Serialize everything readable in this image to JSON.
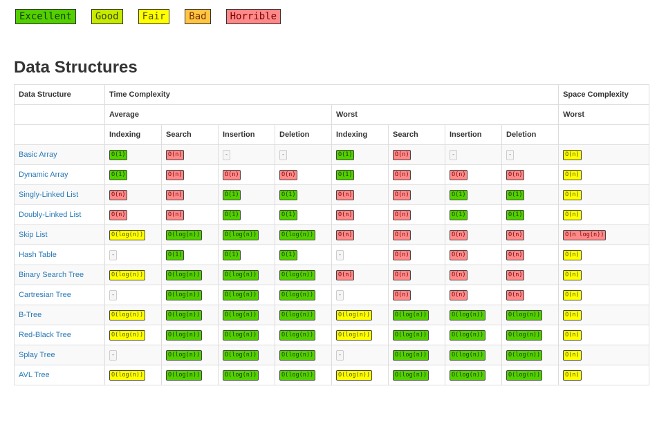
{
  "colors": {
    "excellent": "#53d000",
    "good": "#c8ea00",
    "fair": "#ffff00",
    "bad": "#ffc543",
    "horrible": "#ff8989",
    "link": "#2a7ab8"
  },
  "legend": [
    {
      "label": "Excellent",
      "level": "excellent"
    },
    {
      "label": "Good",
      "level": "good"
    },
    {
      "label": "Fair",
      "level": "fair"
    },
    {
      "label": "Bad",
      "level": "bad"
    },
    {
      "label": "Horrible",
      "level": "horrible"
    }
  ],
  "title": "Data Structures",
  "table": {
    "header": {
      "data_structure": "Data Structure",
      "time_complexity": "Time Complexity",
      "space_complexity": "Space Complexity",
      "average": "Average",
      "worst": "Worst",
      "space_worst": "Worst",
      "ops": [
        "Indexing",
        "Search",
        "Insertion",
        "Deletion",
        "Indexing",
        "Search",
        "Insertion",
        "Deletion"
      ]
    },
    "rows": [
      {
        "name": "Basic Array",
        "cells": [
          {
            "t": "O(1)",
            "c": "excellent"
          },
          {
            "t": "O(n)",
            "c": "horrible"
          },
          {
            "t": "-",
            "c": "none"
          },
          {
            "t": "-",
            "c": "none"
          },
          {
            "t": "O(1)",
            "c": "excellent"
          },
          {
            "t": "O(n)",
            "c": "horrible"
          },
          {
            "t": "-",
            "c": "none"
          },
          {
            "t": "-",
            "c": "none"
          },
          {
            "t": "O(n)",
            "c": "fair"
          }
        ]
      },
      {
        "name": "Dynamic Array",
        "cells": [
          {
            "t": "O(1)",
            "c": "excellent"
          },
          {
            "t": "O(n)",
            "c": "horrible"
          },
          {
            "t": "O(n)",
            "c": "horrible"
          },
          {
            "t": "O(n)",
            "c": "horrible"
          },
          {
            "t": "O(1)",
            "c": "excellent"
          },
          {
            "t": "O(n)",
            "c": "horrible"
          },
          {
            "t": "O(n)",
            "c": "horrible"
          },
          {
            "t": "O(n)",
            "c": "horrible"
          },
          {
            "t": "O(n)",
            "c": "fair"
          }
        ]
      },
      {
        "name": "Singly-Linked List",
        "cells": [
          {
            "t": "O(n)",
            "c": "horrible"
          },
          {
            "t": "O(n)",
            "c": "horrible"
          },
          {
            "t": "O(1)",
            "c": "excellent"
          },
          {
            "t": "O(1)",
            "c": "excellent"
          },
          {
            "t": "O(n)",
            "c": "horrible"
          },
          {
            "t": "O(n)",
            "c": "horrible"
          },
          {
            "t": "O(1)",
            "c": "excellent"
          },
          {
            "t": "O(1)",
            "c": "excellent"
          },
          {
            "t": "O(n)",
            "c": "fair"
          }
        ]
      },
      {
        "name": "Doubly-Linked List",
        "cells": [
          {
            "t": "O(n)",
            "c": "horrible"
          },
          {
            "t": "O(n)",
            "c": "horrible"
          },
          {
            "t": "O(1)",
            "c": "excellent"
          },
          {
            "t": "O(1)",
            "c": "excellent"
          },
          {
            "t": "O(n)",
            "c": "horrible"
          },
          {
            "t": "O(n)",
            "c": "horrible"
          },
          {
            "t": "O(1)",
            "c": "excellent"
          },
          {
            "t": "O(1)",
            "c": "excellent"
          },
          {
            "t": "O(n)",
            "c": "fair"
          }
        ]
      },
      {
        "name": "Skip List",
        "cells": [
          {
            "t": "O(log(n))",
            "c": "fair"
          },
          {
            "t": "O(log(n))",
            "c": "excellent"
          },
          {
            "t": "O(log(n))",
            "c": "excellent"
          },
          {
            "t": "O(log(n))",
            "c": "excellent"
          },
          {
            "t": "O(n)",
            "c": "horrible"
          },
          {
            "t": "O(n)",
            "c": "horrible"
          },
          {
            "t": "O(n)",
            "c": "horrible"
          },
          {
            "t": "O(n)",
            "c": "horrible"
          },
          {
            "t": "O(n log(n))",
            "c": "horrible"
          }
        ]
      },
      {
        "name": "Hash Table",
        "cells": [
          {
            "t": "-",
            "c": "none"
          },
          {
            "t": "O(1)",
            "c": "excellent"
          },
          {
            "t": "O(1)",
            "c": "excellent"
          },
          {
            "t": "O(1)",
            "c": "excellent"
          },
          {
            "t": "-",
            "c": "none"
          },
          {
            "t": "O(n)",
            "c": "horrible"
          },
          {
            "t": "O(n)",
            "c": "horrible"
          },
          {
            "t": "O(n)",
            "c": "horrible"
          },
          {
            "t": "O(n)",
            "c": "fair"
          }
        ]
      },
      {
        "name": "Binary Search Tree",
        "cells": [
          {
            "t": "O(log(n))",
            "c": "fair"
          },
          {
            "t": "O(log(n))",
            "c": "excellent"
          },
          {
            "t": "O(log(n))",
            "c": "excellent"
          },
          {
            "t": "O(log(n))",
            "c": "excellent"
          },
          {
            "t": "O(n)",
            "c": "horrible"
          },
          {
            "t": "O(n)",
            "c": "horrible"
          },
          {
            "t": "O(n)",
            "c": "horrible"
          },
          {
            "t": "O(n)",
            "c": "horrible"
          },
          {
            "t": "O(n)",
            "c": "fair"
          }
        ]
      },
      {
        "name": "Cartresian Tree",
        "cells": [
          {
            "t": "-",
            "c": "none"
          },
          {
            "t": "O(log(n))",
            "c": "excellent"
          },
          {
            "t": "O(log(n))",
            "c": "excellent"
          },
          {
            "t": "O(log(n))",
            "c": "excellent"
          },
          {
            "t": "-",
            "c": "none"
          },
          {
            "t": "O(n)",
            "c": "horrible"
          },
          {
            "t": "O(n)",
            "c": "horrible"
          },
          {
            "t": "O(n)",
            "c": "horrible"
          },
          {
            "t": "O(n)",
            "c": "fair"
          }
        ]
      },
      {
        "name": "B-Tree",
        "cells": [
          {
            "t": "O(log(n))",
            "c": "fair"
          },
          {
            "t": "O(log(n))",
            "c": "excellent"
          },
          {
            "t": "O(log(n))",
            "c": "excellent"
          },
          {
            "t": "O(log(n))",
            "c": "excellent"
          },
          {
            "t": "O(log(n))",
            "c": "fair"
          },
          {
            "t": "O(log(n))",
            "c": "excellent"
          },
          {
            "t": "O(log(n))",
            "c": "excellent"
          },
          {
            "t": "O(log(n))",
            "c": "excellent"
          },
          {
            "t": "O(n)",
            "c": "fair"
          }
        ]
      },
      {
        "name": "Red-Black Tree",
        "cells": [
          {
            "t": "O(log(n))",
            "c": "fair"
          },
          {
            "t": "O(log(n))",
            "c": "excellent"
          },
          {
            "t": "O(log(n))",
            "c": "excellent"
          },
          {
            "t": "O(log(n))",
            "c": "excellent"
          },
          {
            "t": "O(log(n))",
            "c": "fair"
          },
          {
            "t": "O(log(n))",
            "c": "excellent"
          },
          {
            "t": "O(log(n))",
            "c": "excellent"
          },
          {
            "t": "O(log(n))",
            "c": "excellent"
          },
          {
            "t": "O(n)",
            "c": "fair"
          }
        ]
      },
      {
        "name": "Splay Tree",
        "cells": [
          {
            "t": "-",
            "c": "none"
          },
          {
            "t": "O(log(n))",
            "c": "excellent"
          },
          {
            "t": "O(log(n))",
            "c": "excellent"
          },
          {
            "t": "O(log(n))",
            "c": "excellent"
          },
          {
            "t": "-",
            "c": "none"
          },
          {
            "t": "O(log(n))",
            "c": "excellent"
          },
          {
            "t": "O(log(n))",
            "c": "excellent"
          },
          {
            "t": "O(log(n))",
            "c": "excellent"
          },
          {
            "t": "O(n)",
            "c": "fair"
          }
        ]
      },
      {
        "name": "AVL Tree",
        "cells": [
          {
            "t": "O(log(n))",
            "c": "fair"
          },
          {
            "t": "O(log(n))",
            "c": "excellent"
          },
          {
            "t": "O(log(n))",
            "c": "excellent"
          },
          {
            "t": "O(log(n))",
            "c": "excellent"
          },
          {
            "t": "O(log(n))",
            "c": "fair"
          },
          {
            "t": "O(log(n))",
            "c": "excellent"
          },
          {
            "t": "O(log(n))",
            "c": "excellent"
          },
          {
            "t": "O(log(n))",
            "c": "excellent"
          },
          {
            "t": "O(n)",
            "c": "fair"
          }
        ]
      }
    ]
  }
}
